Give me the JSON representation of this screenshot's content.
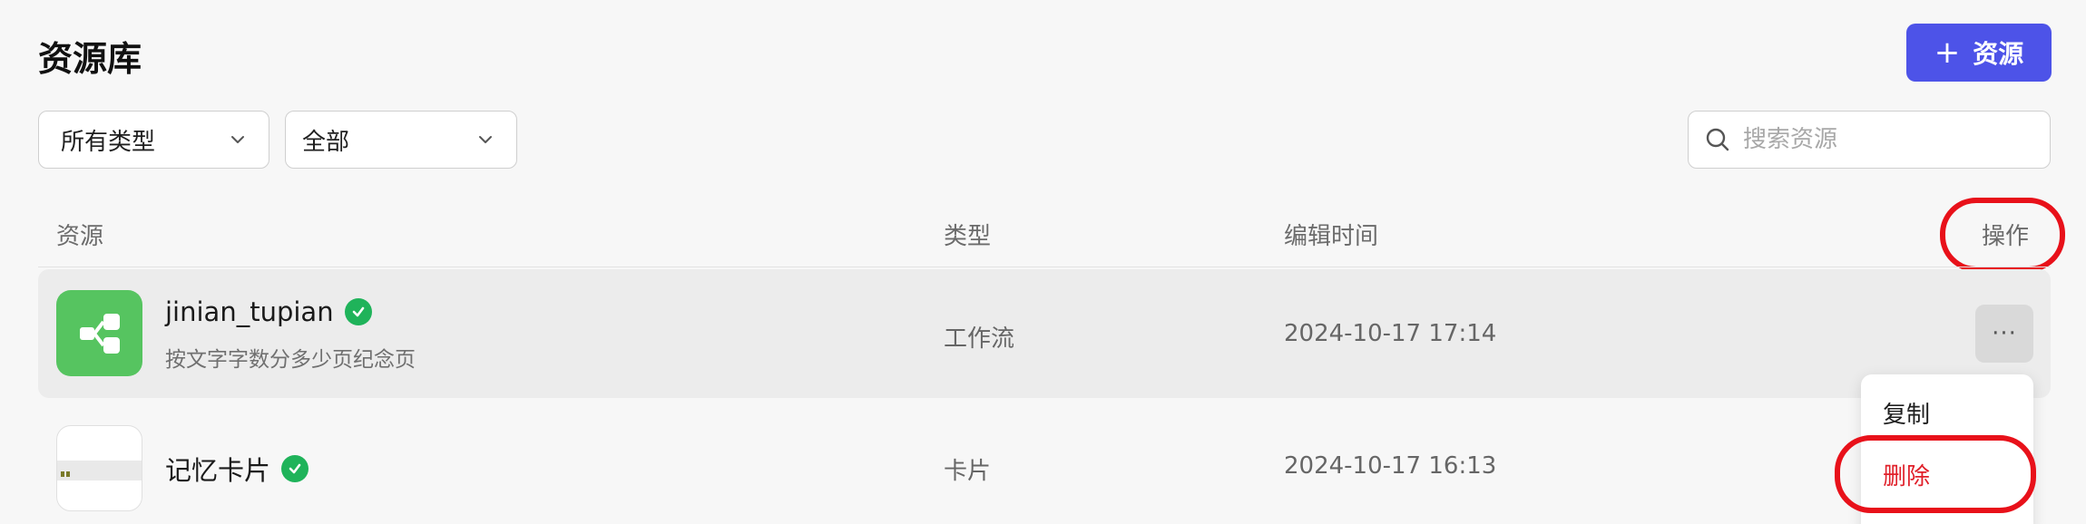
{
  "page": {
    "title": "资源库"
  },
  "toolbar": {
    "add_label": "资源",
    "add_icon": "plus-icon"
  },
  "filters": {
    "type_value": "所有类型",
    "status_value": "全部",
    "search_placeholder": "搜索资源"
  },
  "table": {
    "headers": {
      "resource": "资源",
      "type": "类型",
      "edited": "编辑时间",
      "actions": "操作"
    },
    "rows": [
      {
        "name": "jinian_tupian",
        "description": "按文字字数分多少页纪念页",
        "type": "工作流",
        "edited": "2024-10-17 17:14",
        "icon": "workflow-icon",
        "verified": true
      },
      {
        "name": "记忆卡片",
        "type": "卡片",
        "edited": "2024-10-17 16:13",
        "icon": "card-thumbnail",
        "verified": true
      }
    ]
  },
  "context_menu": {
    "copy": "复制",
    "delete": "删除"
  },
  "colors": {
    "accent": "#4d53e8",
    "verified": "#1fb35a",
    "danger": "#e0202a",
    "highlight_annotation": "#e8111a",
    "workflow_icon_bg": "#56c460"
  }
}
